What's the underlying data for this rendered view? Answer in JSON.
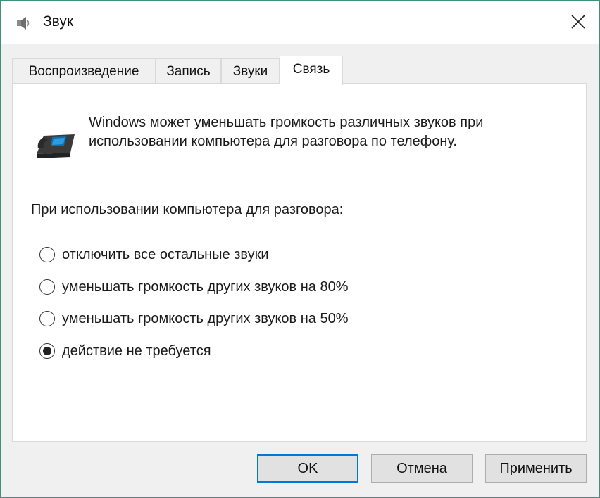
{
  "window": {
    "title": "Звук",
    "icon": "speaker-icon",
    "close_icon": "close-icon"
  },
  "tabs": [
    {
      "label": "Воспроизведение",
      "active": false
    },
    {
      "label": "Запись",
      "active": false
    },
    {
      "label": "Звуки",
      "active": false
    },
    {
      "label": "Связь",
      "active": true
    }
  ],
  "communications": {
    "icon": "telephone-icon",
    "description": "Windows может уменьшать громкость различных звуков при использовании компьютера для разговора по телефону.",
    "group_label": "При использовании компьютера для разговора:",
    "options": [
      {
        "label": "отключить все остальные звуки",
        "selected": false
      },
      {
        "label": "уменьшать громкость других звуков на 80%",
        "selected": false
      },
      {
        "label": "уменьшать громкость других звуков на 50%",
        "selected": false
      },
      {
        "label": "действие не требуется",
        "selected": true
      }
    ]
  },
  "buttons": {
    "ok": "OK",
    "cancel": "Отмена",
    "apply": "Применить"
  },
  "colors": {
    "window_border": "#3f8f7a",
    "default_button_border": "#0078d7"
  }
}
